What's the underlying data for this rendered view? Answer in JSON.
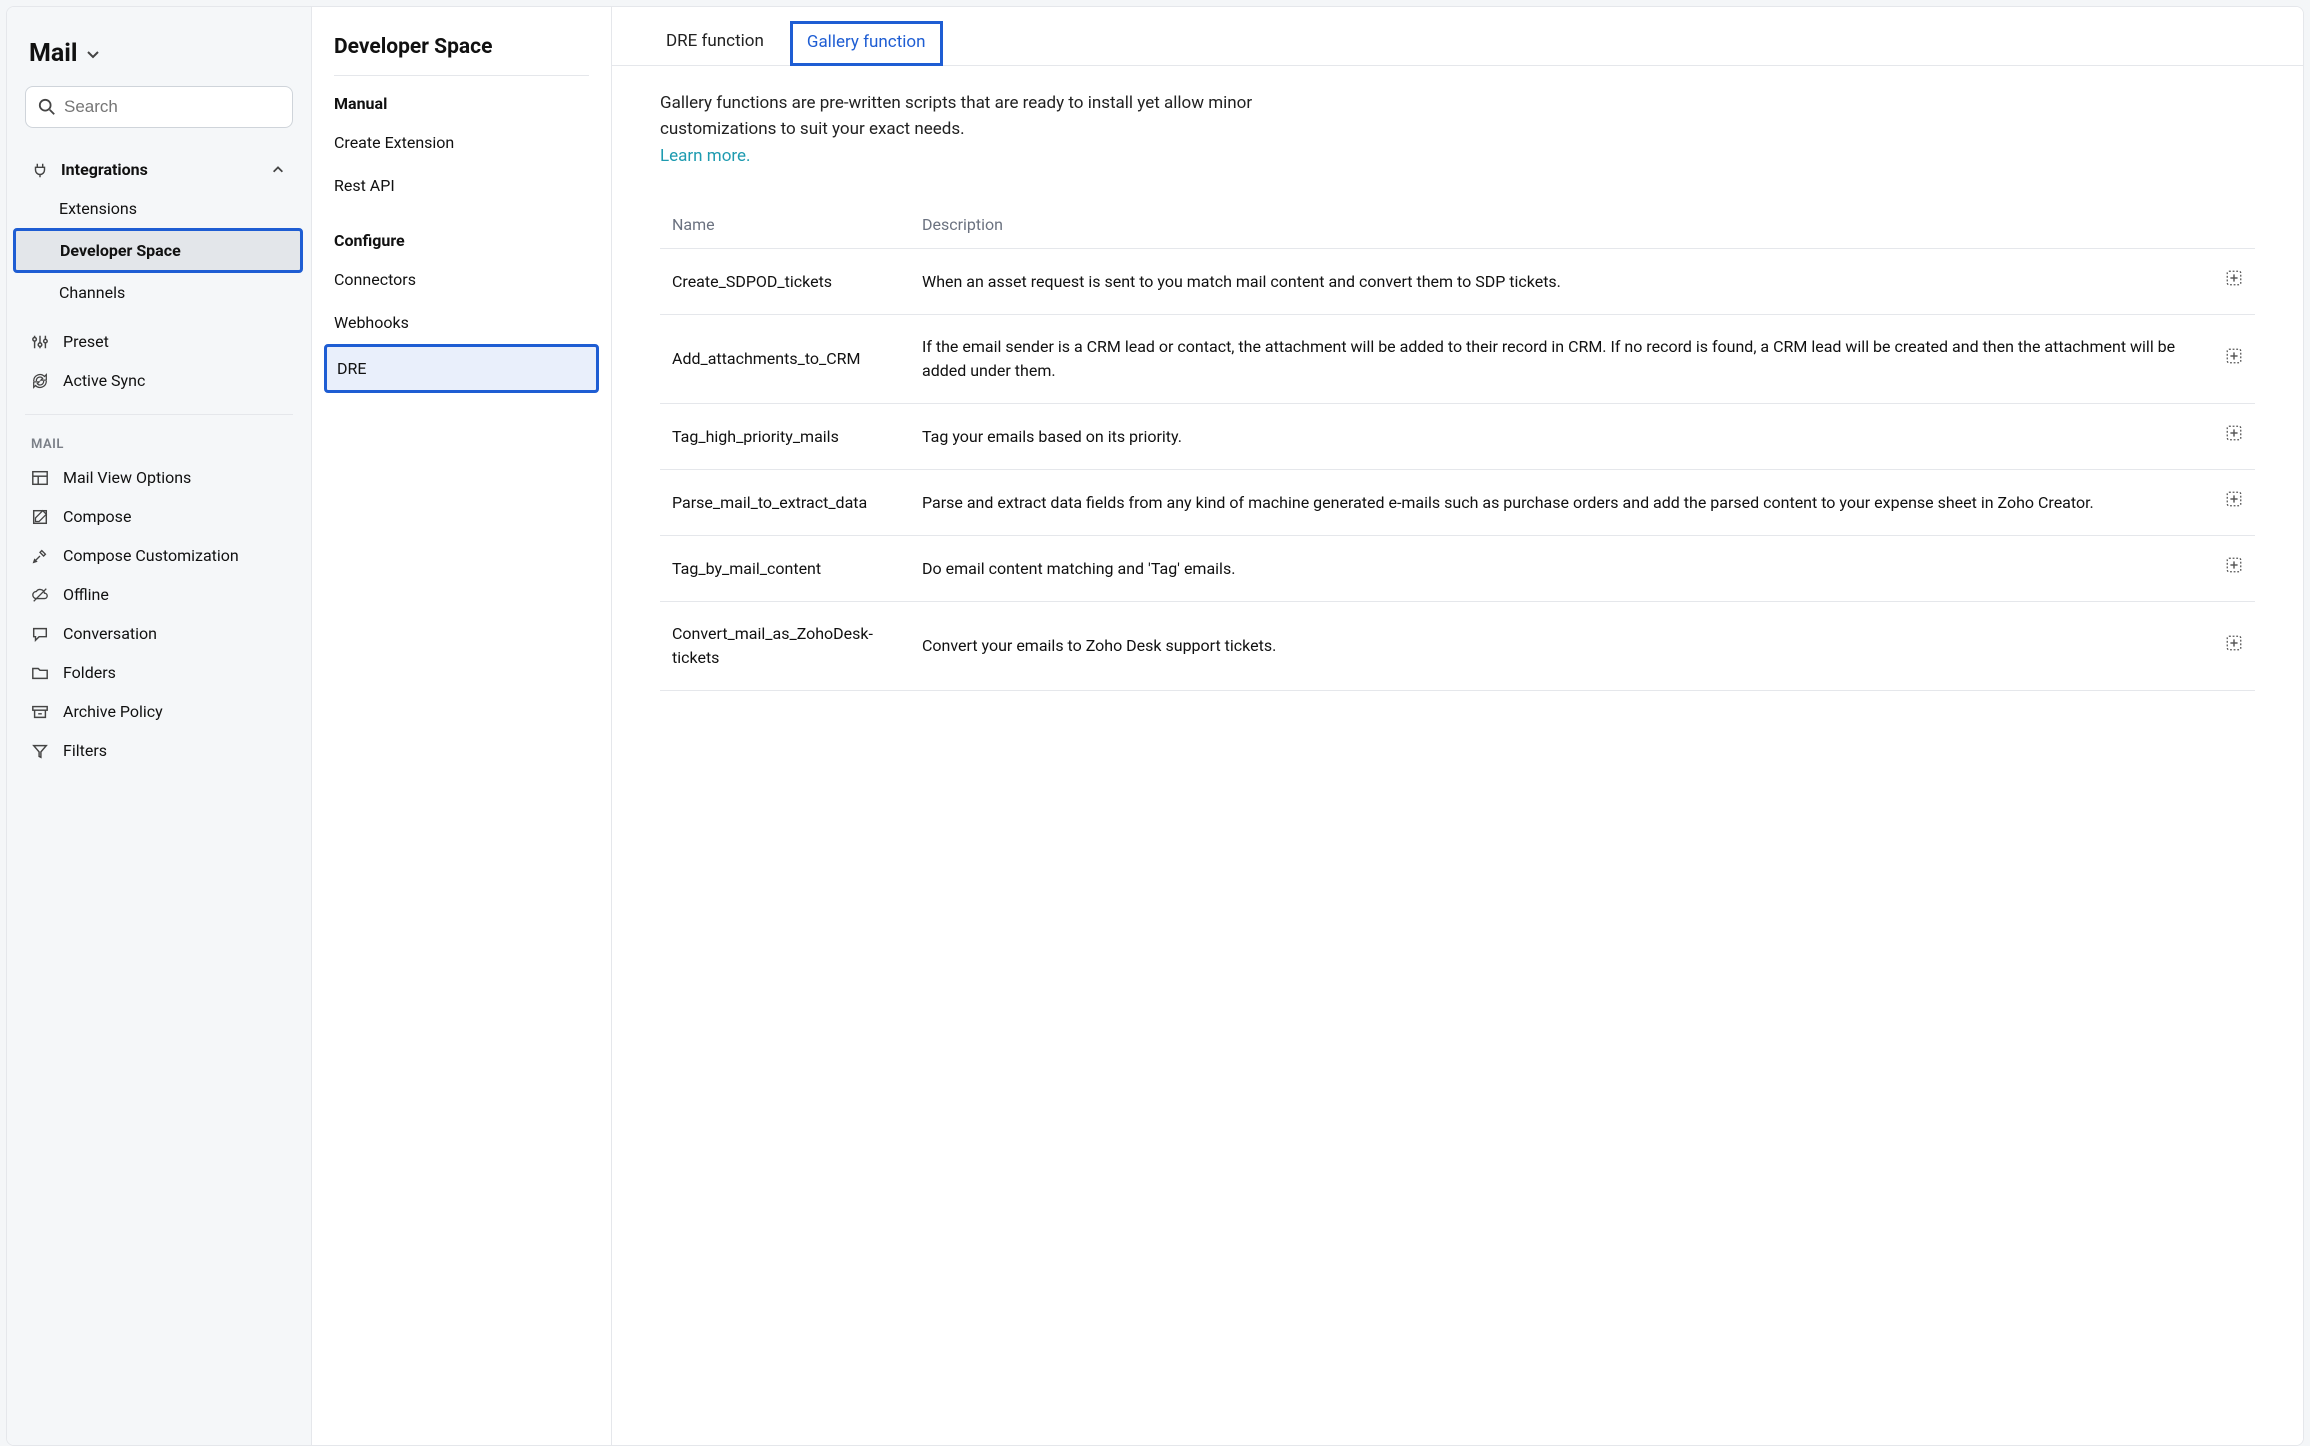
{
  "sidebar": {
    "title": "Mail",
    "search_placeholder": "Search",
    "integrations": {
      "label": "Integrations",
      "children": {
        "extensions": "Extensions",
        "developer_space": "Developer Space",
        "channels": "Channels"
      }
    },
    "preset": "Preset",
    "active_sync": "Active Sync",
    "section_mail": "MAIL",
    "mail_items": {
      "mail_view_options": "Mail View Options",
      "compose": "Compose",
      "compose_customization": "Compose Customization",
      "offline": "Offline",
      "conversation": "Conversation",
      "folders": "Folders",
      "archive_policy": "Archive Policy",
      "filters": "Filters"
    }
  },
  "midpanel": {
    "title": "Developer Space",
    "section_manual": "Manual",
    "manual_items": {
      "create_extension": "Create Extension",
      "rest_api": "Rest API"
    },
    "section_configure": "Configure",
    "configure_items": {
      "connectors": "Connectors",
      "webhooks": "Webhooks",
      "dre": "DRE"
    }
  },
  "main": {
    "tabs": {
      "dre": "DRE function",
      "gallery": "Gallery function"
    },
    "intro": "Gallery functions are pre-written scripts that are ready to install yet allow minor customizations to suit your exact needs.",
    "learn_more": "Learn more.",
    "table": {
      "col_name": "Name",
      "col_desc": "Description",
      "rows": [
        {
          "name": "Create_SDPOD_tickets",
          "desc": "When an asset request is sent to you match mail content and convert them to SDP tickets."
        },
        {
          "name": "Add_attachments_to_CRM",
          "desc": "If the email sender is a CRM lead or contact, the attachment will be added to their record in CRM. If no record is found, a CRM lead will be created and then the attachment will be added under them."
        },
        {
          "name": "Tag_high_priority_mails",
          "desc": "Tag your emails based on its priority."
        },
        {
          "name": "Parse_mail_to_extract_data",
          "desc": "Parse and extract data fields from any kind of machine generated e-mails such as purchase orders and add the parsed content to your expense sheet in Zoho Creator."
        },
        {
          "name": "Tag_by_mail_content",
          "desc": "Do email content matching and 'Tag' emails."
        },
        {
          "name": "Convert_mail_as_ZohoDesk-tickets",
          "desc": "Convert your emails to Zoho Desk support tickets."
        }
      ]
    }
  }
}
